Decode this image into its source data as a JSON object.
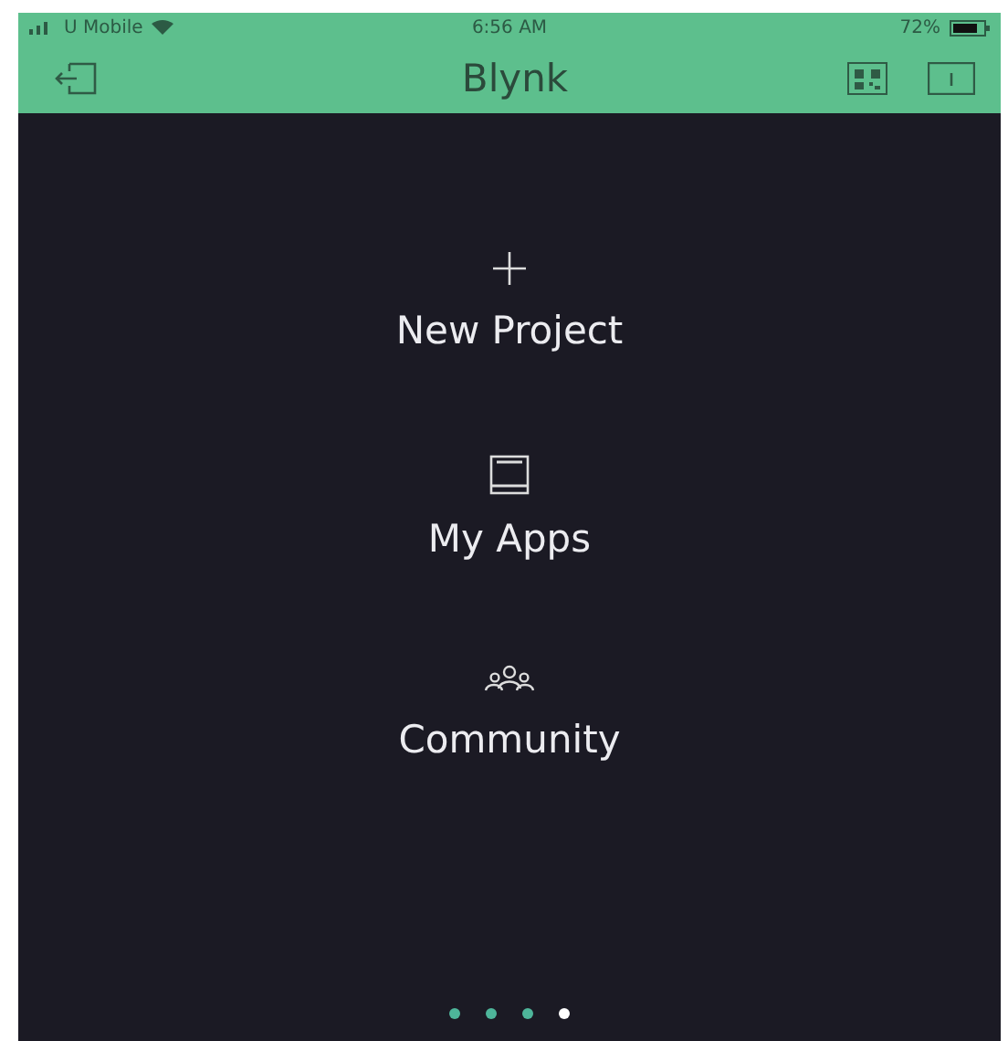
{
  "status_bar": {
    "carrier": "U Mobile",
    "time": "6:56 AM",
    "battery": "72%"
  },
  "nav_bar": {
    "title": "Blynk"
  },
  "menu": [
    {
      "kind": "plus",
      "label": "New Project"
    },
    {
      "kind": "apps",
      "label": "My Apps"
    },
    {
      "kind": "people",
      "label": "Community"
    }
  ],
  "page_dots": [
    {
      "selected": false
    },
    {
      "selected": false
    },
    {
      "selected": false
    },
    {
      "selected": true
    }
  ]
}
